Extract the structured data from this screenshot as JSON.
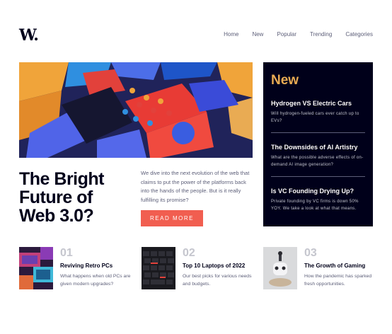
{
  "logo": "W.",
  "nav": [
    "Home",
    "New",
    "Popular",
    "Trending",
    "Categories"
  ],
  "hero": {
    "title_lines": [
      "The Bright",
      "Future of",
      "Web 3.0?"
    ],
    "description": "We dive into the next evolution of the web that claims to put the power of the platforms back into the hands of the people. But is it really fulfilling its promise?",
    "button": "READ MORE"
  },
  "new_panel": {
    "heading": "New",
    "items": [
      {
        "title": "Hydrogen VS Electric Cars",
        "desc": "Will hydrogen-fueled cars ever catch up to EVs?"
      },
      {
        "title": "The Downsides of AI Artistry",
        "desc": "What are the possible adverse effects of on-demand AI image generation?"
      },
      {
        "title": "Is VC Founding Drying Up?",
        "desc": "Private founding by VC firms is down 50% YOY. We take a look at what that means."
      }
    ]
  },
  "cards": [
    {
      "num": "01",
      "title": "Reviving Retro PCs",
      "desc": "What happens when old PCs are given modern upgrades?"
    },
    {
      "num": "02",
      "title": "Top 10 Laptops of 2022",
      "desc": "Our best picks for various needs and budgets."
    },
    {
      "num": "03",
      "title": "The Growth of Gaming",
      "desc": "How the pandemic has sparked fresh opportunities."
    }
  ],
  "colors": {
    "accent": "#f15e50",
    "panel_bg": "#00001a",
    "panel_heading": "#e9ab53",
    "muted": "#5d5f79"
  }
}
